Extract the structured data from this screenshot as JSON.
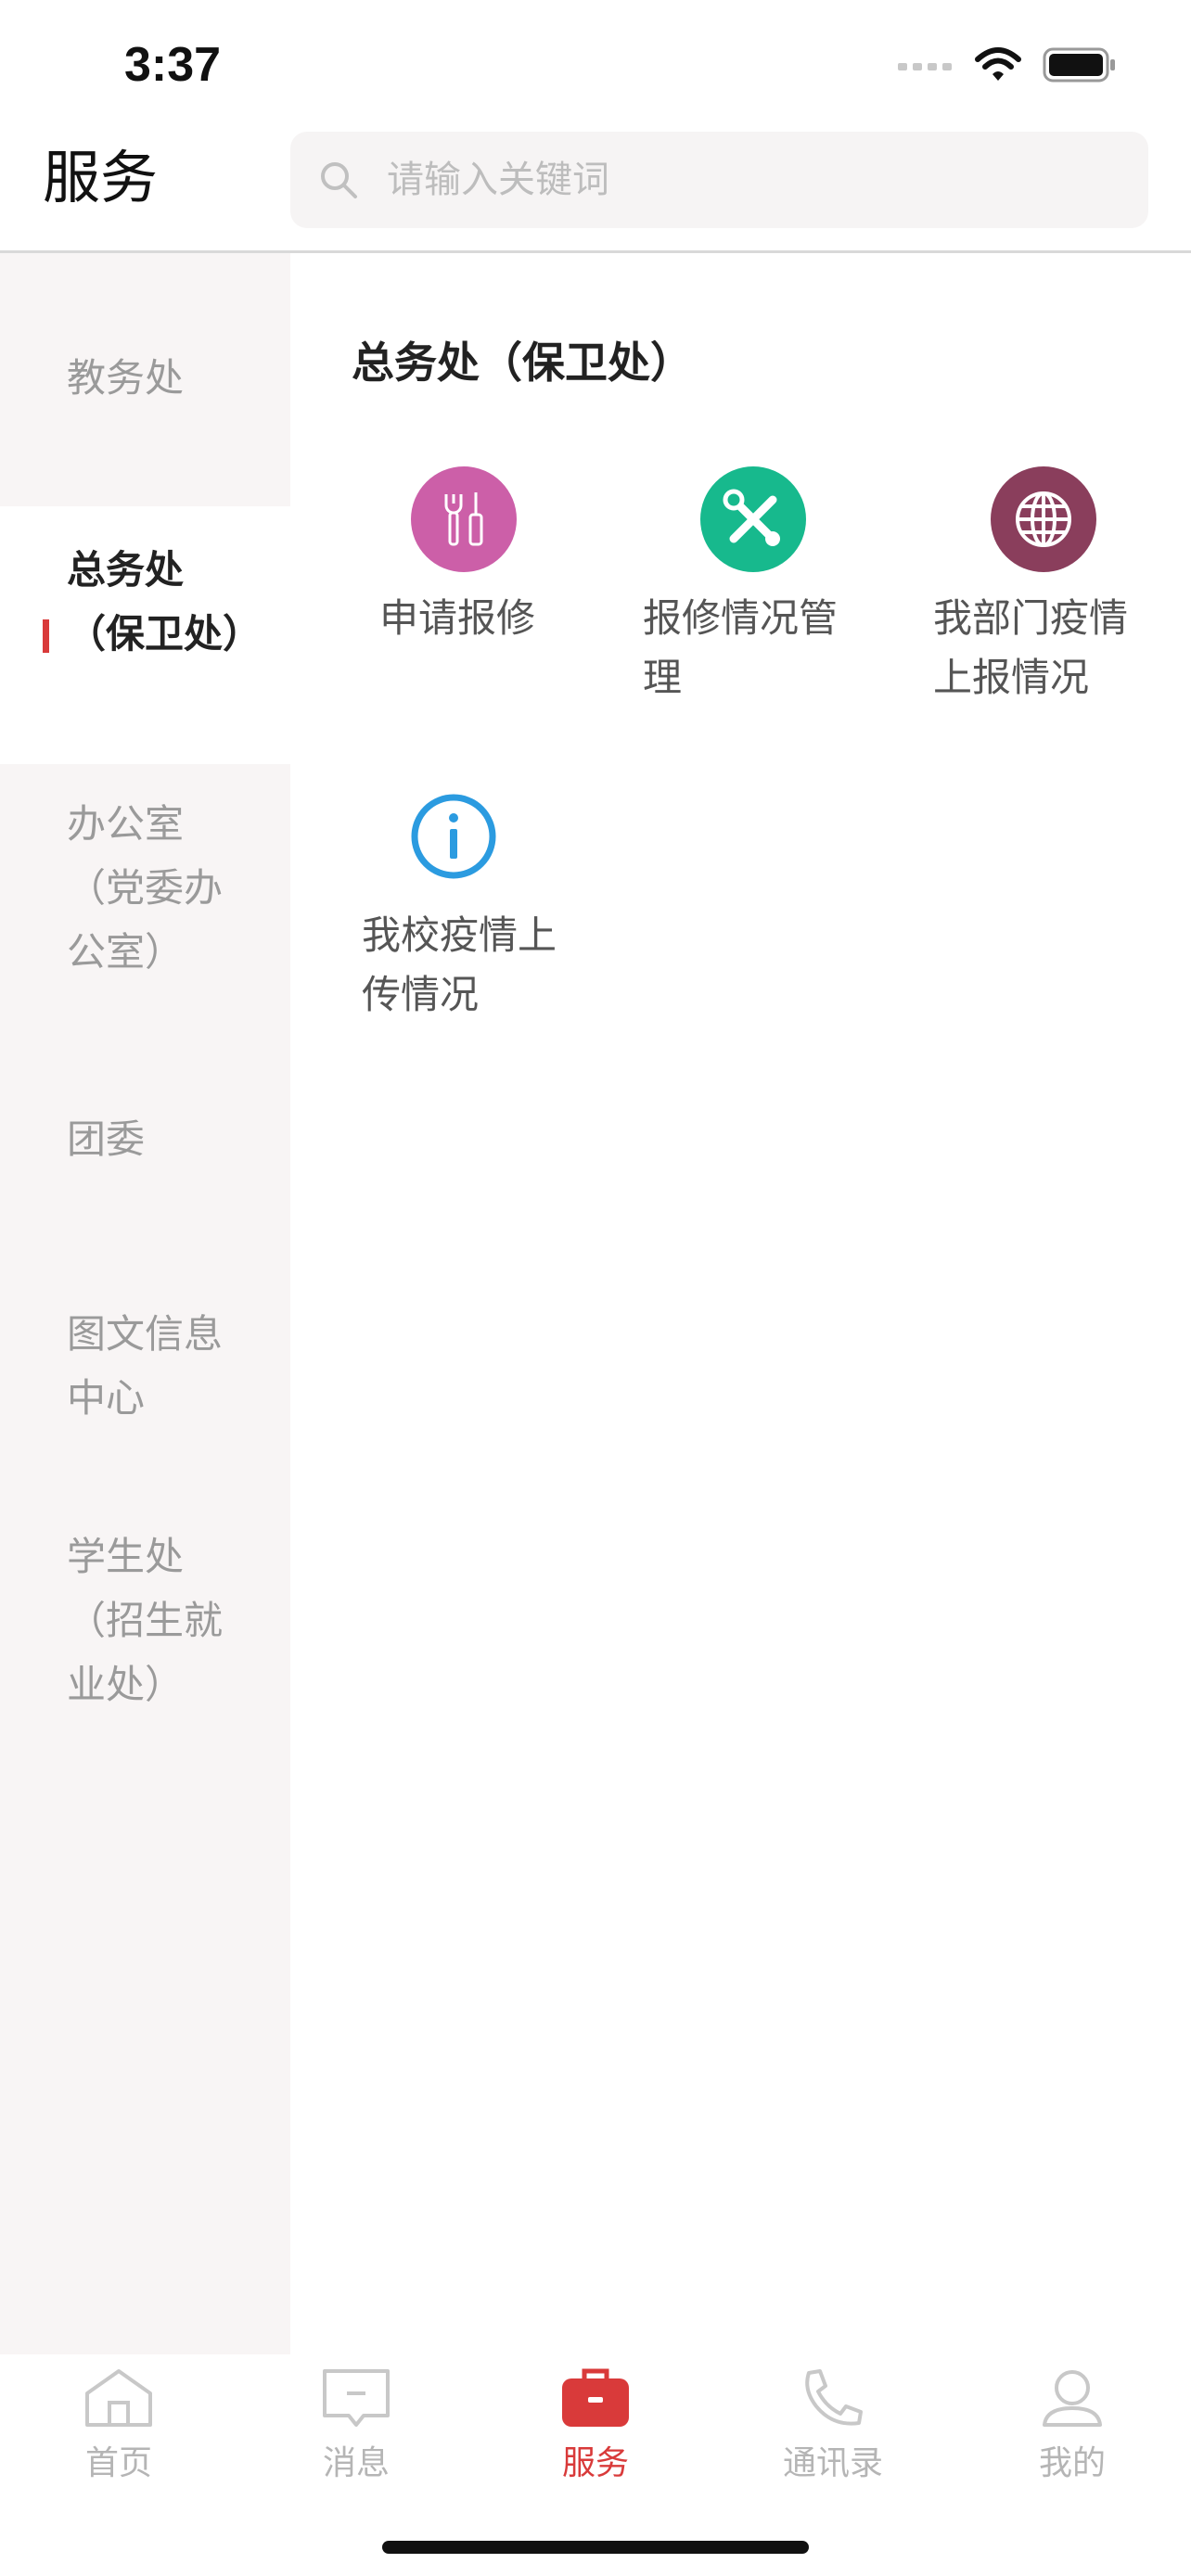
{
  "status_bar": {
    "time": "3:37"
  },
  "header": {
    "title": "服务",
    "search_placeholder": "请输入关键词"
  },
  "sidebar": {
    "items": [
      {
        "label": "教务处"
      },
      {
        "label": "总务处（保卫处）"
      },
      {
        "label": "办公室（党委办公室）"
      },
      {
        "label": "团委"
      },
      {
        "label": "图文信息中心"
      },
      {
        "label": "学生处（招生就业处）"
      }
    ]
  },
  "main": {
    "section_title": "总务处（保卫处）",
    "services": [
      {
        "label": "申请报修",
        "icon": "tools-icon",
        "color": "#cc5fa8"
      },
      {
        "label": "报修情况管理",
        "icon": "wrench-screwdriver-icon",
        "color": "#17b98d"
      },
      {
        "label": "我部门疫情上报情况",
        "icon": "globe-icon",
        "color": "#8a3e5c"
      },
      {
        "label": "我校疫情上传情况",
        "icon": "info-icon",
        "color": "#2b9be0"
      }
    ]
  },
  "tab_bar": {
    "tabs": [
      {
        "label": "首页",
        "icon": "home-icon"
      },
      {
        "label": "消息",
        "icon": "message-icon"
      },
      {
        "label": "服务",
        "icon": "briefcase-icon",
        "active": true
      },
      {
        "label": "通讯录",
        "icon": "phone-icon"
      },
      {
        "label": "我的",
        "icon": "user-icon"
      }
    ]
  },
  "colors": {
    "accent": "#d93a3a",
    "sidebar_bg": "#f8f5f5",
    "search_bg": "#f6f4f4"
  }
}
